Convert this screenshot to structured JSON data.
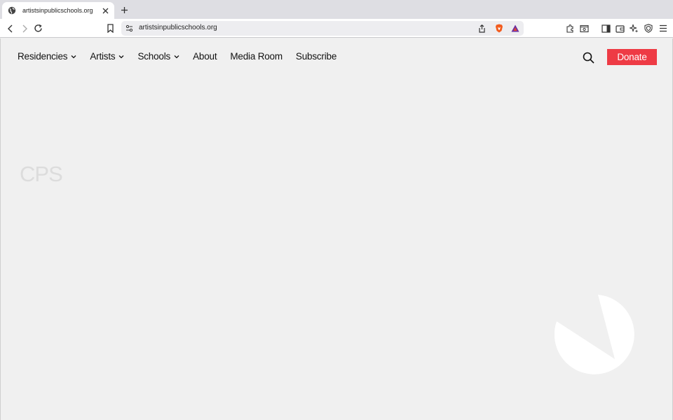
{
  "browser": {
    "tab_title": "artistsinpublicschools.org",
    "address": "artistsinpublicschools.org"
  },
  "site": {
    "nav_items": [
      "Residencies",
      "Artists",
      "Schools",
      "About",
      "Media Room",
      "Subscribe"
    ],
    "donate_label": "Donate",
    "hero_text": "CPS"
  },
  "colors": {
    "accent": "#ee3b45",
    "page_bg": "#f0f0f0"
  },
  "icons": {
    "tab_favicon": "globe-icon",
    "search": "search-icon",
    "logo": "circle-slice-logo"
  }
}
